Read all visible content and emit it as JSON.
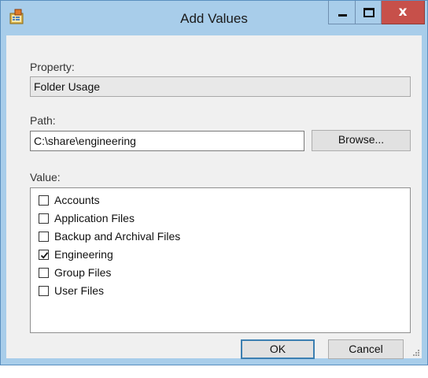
{
  "window": {
    "title": "Add Values",
    "icon": "property-editor-icon",
    "controls": {
      "minimize": "minimize-icon",
      "maximize": "maximize-icon",
      "close": "x"
    }
  },
  "property": {
    "label": "Property:",
    "value": "Folder Usage"
  },
  "path": {
    "label": "Path:",
    "value": "C:\\share\\engineering",
    "browse_label": "Browse..."
  },
  "value_list": {
    "label": "Value:",
    "items": [
      {
        "label": "Accounts",
        "checked": false
      },
      {
        "label": "Application Files",
        "checked": false
      },
      {
        "label": "Backup and Archival Files",
        "checked": false
      },
      {
        "label": "Engineering",
        "checked": true
      },
      {
        "label": "Group Files",
        "checked": false
      },
      {
        "label": "User Files",
        "checked": false
      }
    ]
  },
  "buttons": {
    "ok": "OK",
    "cancel": "Cancel"
  },
  "colors": {
    "frame": "#a8cdea",
    "close_button": "#c7504a",
    "client": "#f0f0f0"
  }
}
